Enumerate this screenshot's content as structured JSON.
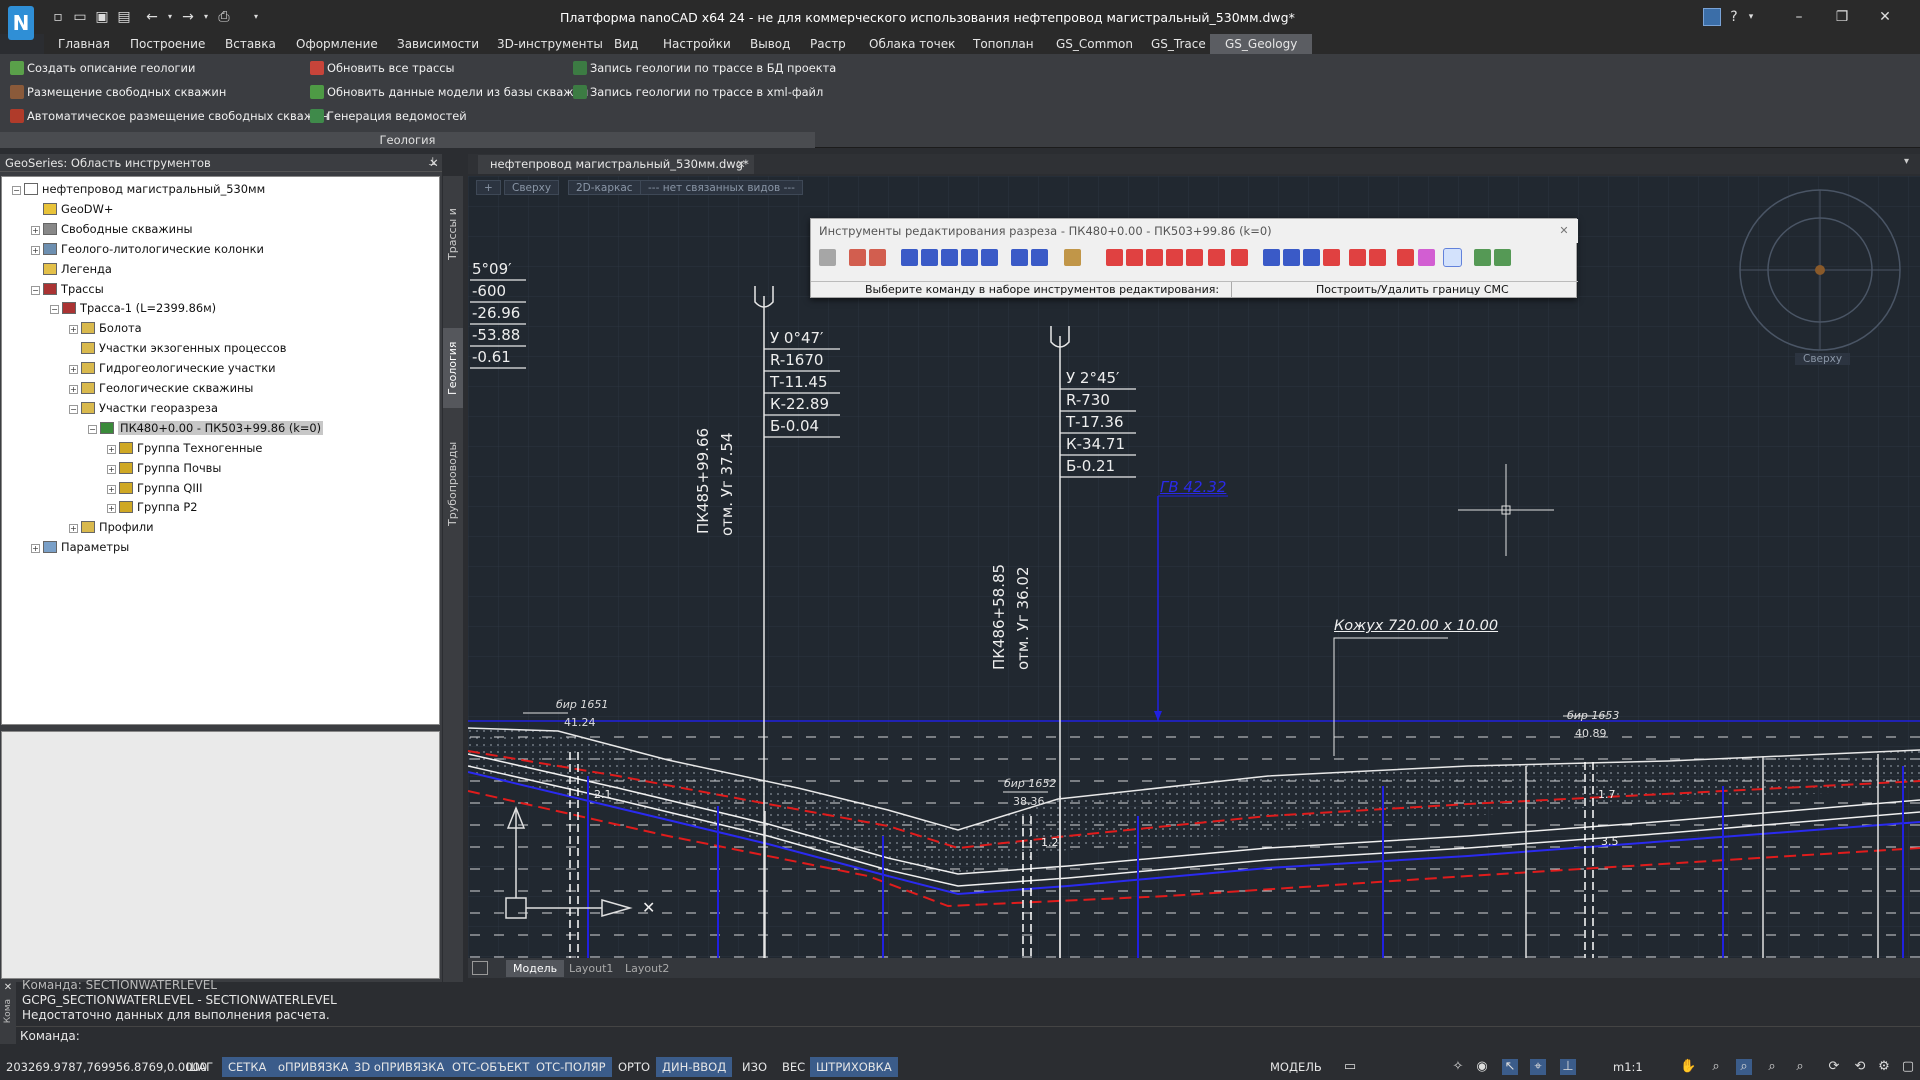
{
  "app": {
    "title": "Платформа nanoCAD x64 24 - не для коммерческого использования нефтепровод магистральный_530мм.dwg*",
    "logo": "N",
    "window_controls": [
      "–",
      "❐",
      "✕"
    ],
    "help": "?"
  },
  "menu": [
    "Главная",
    "Построение",
    "Вставка",
    "Оформление",
    "Зависимости",
    "3D-инструменты",
    "Вид",
    "Настройки",
    "Вывод",
    "Растр",
    "Облака точек",
    "Топоплан",
    "GS_Common",
    "GS_Trace",
    "GS_Geology"
  ],
  "ribbon": {
    "col1": [
      "Создать описание геологии",
      "Размещение свободных скважин",
      "Автоматическое размещение свободных скважин"
    ],
    "col2": [
      "Обновить все трассы",
      "Обновить данные модели из базы скважин",
      "Генерация ведомостей"
    ],
    "col3": [
      "Запись геологии по трассе в БД проекта",
      "Запись геологии по трассе в xml-файл"
    ],
    "group_label": "Геология"
  },
  "panel": {
    "title": "GeoSeries: Область инструментов",
    "pin": "⊥",
    "close": "✕",
    "vtabs": [
      "Трассы и Профили",
      "Геология",
      "Трубопроводы"
    ],
    "tree": [
      {
        "label": "нефтепровод магистральный_530мм",
        "level": 0,
        "exp": "−"
      },
      {
        "label": "GeoDW+",
        "level": 1,
        "exp": ""
      },
      {
        "label": "Свободные скважины",
        "level": 1,
        "exp": "+"
      },
      {
        "label": "Геолого-литологические колонки",
        "level": 1,
        "exp": "+"
      },
      {
        "label": "Легенда",
        "level": 1,
        "exp": ""
      },
      {
        "label": "Трассы",
        "level": 1,
        "exp": "−"
      },
      {
        "label": "Трасса-1 (L=2399.86м)",
        "level": 2,
        "exp": "−"
      },
      {
        "label": "Болота",
        "level": 3,
        "exp": "+"
      },
      {
        "label": "Участки экзогенных процессов",
        "level": 3,
        "exp": ""
      },
      {
        "label": "Гидрогеологические участки",
        "level": 3,
        "exp": "+"
      },
      {
        "label": "Геологические скважины",
        "level": 3,
        "exp": "+"
      },
      {
        "label": "Участки георазреза",
        "level": 3,
        "exp": "−"
      },
      {
        "label": "ПК480+0.00 - ПК503+99.86 (k=0)",
        "level": 4,
        "exp": "−",
        "selected": true
      },
      {
        "label": "Группа Техногенные",
        "level": 5,
        "exp": "+"
      },
      {
        "label": "Группа Почвы",
        "level": 5,
        "exp": "+"
      },
      {
        "label": "Группа QIII",
        "level": 5,
        "exp": "+"
      },
      {
        "label": "Группа P2",
        "level": 5,
        "exp": "+"
      },
      {
        "label": "Профили",
        "level": 3,
        "exp": "+"
      },
      {
        "label": "Параметры",
        "level": 1,
        "exp": "+"
      }
    ]
  },
  "document": {
    "tab": "нефтепровод магистральный_530мм.dwg*",
    "view_buttons": [
      "+",
      "Сверху",
      "2D-каркас",
      "--- нет связанных видов ---"
    ],
    "layout_tabs": [
      "Модель",
      "Layout1",
      "Layout2"
    ],
    "viewcube_label": "Сверху"
  },
  "edit_tool": {
    "title": "Инструменты редактирования разреза - ПК480+0.00 - ПК503+99.86 (k=0)",
    "status_left": "Выберите команду в наборе инструментов редактирования:",
    "status_right": "Построить/Удалить границу СМС"
  },
  "drawing": {
    "left_labels": [
      "5°09′",
      "-600",
      "-26.96",
      "-53.88",
      "-0.61"
    ],
    "curve1": [
      "У 0°47′",
      "R-1670",
      "Т-11.45",
      "К-22.89",
      "Б-0.04"
    ],
    "curve2": [
      "У 2°45′",
      "R-730",
      "Т-17.36",
      "К-34.71",
      "Б-0.21"
    ],
    "pk1": "ПК485+99.66",
    "elev1": "отм. Уг 37.54",
    "pk2": "ПК486+58.85",
    "elev2": "отм. Уг 36.02",
    "gv": "ГВ 42.32",
    "casing": "Кожух 720.00 х 10.00",
    "well1": {
      "name": "бир 1651",
      "value": "41.24"
    },
    "well2": {
      "name": "бир 1652",
      "value": "38.36"
    },
    "well3": {
      "name": "бир 1653",
      "value": "40.89"
    },
    "marks": [
      "1.2",
      "1.7",
      "3.5",
      "2.1"
    ]
  },
  "command": {
    "lines": [
      "Команда: SECTIONWATERLEVEL",
      "GCPG_SECTIONWATERLEVEL - SECTIONWATERLEVEL",
      "Недостаточно данных для выполнения расчета."
    ],
    "prompt": "Команда:",
    "side_label": "Кома"
  },
  "status": {
    "coords": "203269.9787,769956.8769,0.0000",
    "toggles": [
      {
        "label": "ШАГ",
        "on": false
      },
      {
        "label": "СЕТКА",
        "on": true
      },
      {
        "label": "оПРИВЯЗКА",
        "on": true
      },
      {
        "label": "3D оПРИВЯЗКА",
        "on": true
      },
      {
        "label": "ОТС-ОБЪЕКТ",
        "on": true
      },
      {
        "label": "ОТС-ПОЛЯР",
        "on": true
      },
      {
        "label": "ОРТО",
        "on": false
      },
      {
        "label": "ДИН-ВВОД",
        "on": true
      },
      {
        "label": "ИЗО",
        "on": false
      },
      {
        "label": "ВЕС",
        "on": false
      },
      {
        "label": "ШТРИХОВКА",
        "on": true
      }
    ],
    "mode": "МОДЕЛЬ",
    "scale": "m1:1"
  },
  "colors": {
    "accent": "#2f8fd6",
    "active_toggle": "#3b5c8a",
    "canvas": "#212830"
  }
}
